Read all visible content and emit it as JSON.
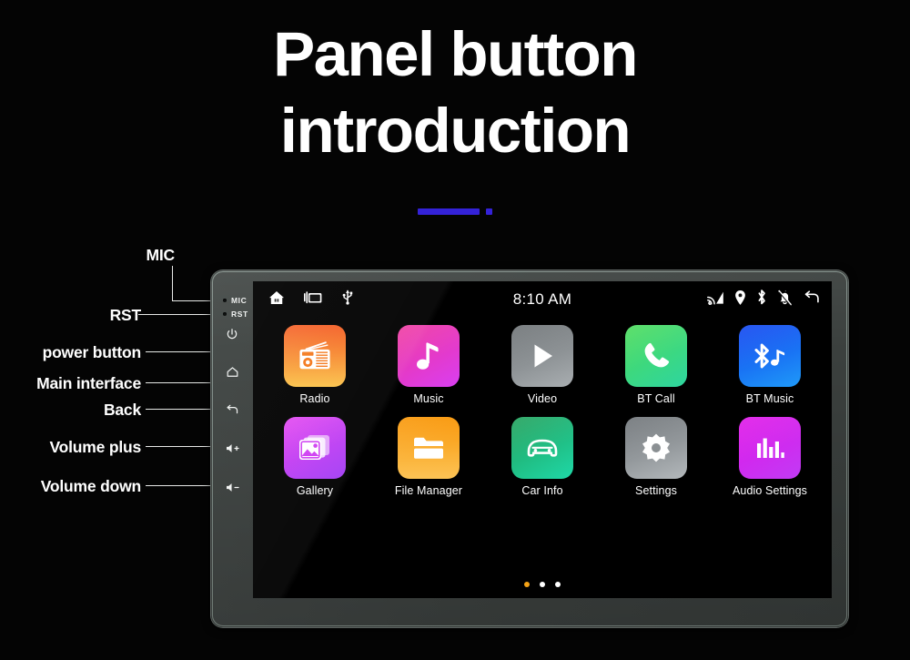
{
  "page": {
    "title_line1": "Panel button",
    "title_line2": "introduction",
    "accent_color": "#3422d8",
    "background_color": "#040404"
  },
  "annotations": [
    {
      "label": "MIC",
      "target": "mic-port"
    },
    {
      "label": "RST",
      "target": "reset-port"
    },
    {
      "label": "power button",
      "target": "power-button"
    },
    {
      "label": "Main interface",
      "target": "home-button"
    },
    {
      "label": "Back",
      "target": "back-button"
    },
    {
      "label": "Volume plus",
      "target": "volume-up-button"
    },
    {
      "label": "Volume down",
      "target": "volume-down-button"
    }
  ],
  "device": {
    "bezel_buttons": [
      {
        "name": "mic-port",
        "glyph_type": "text",
        "text": "MIC"
      },
      {
        "name": "reset-port",
        "glyph_type": "text",
        "text": "RST"
      },
      {
        "name": "power-button",
        "glyph_type": "icon",
        "icon": "power-icon"
      },
      {
        "name": "home-button",
        "glyph_type": "icon",
        "icon": "home-icon"
      },
      {
        "name": "back-button",
        "glyph_type": "icon",
        "icon": "back-arrow-icon"
      },
      {
        "name": "volume-up-button",
        "glyph_type": "icon",
        "icon": "volume-up-icon"
      },
      {
        "name": "volume-down-button",
        "glyph_type": "icon",
        "icon": "volume-down-icon"
      }
    ]
  },
  "screen": {
    "status_bar": {
      "clock": "8:10 AM",
      "left_icons": [
        "home-icon",
        "recent-apps-icon",
        "usb-icon"
      ],
      "right_icons": [
        "cast-icon",
        "location-pin-icon",
        "bluetooth-icon",
        "notifications-off-icon",
        "back-arrow-icon"
      ]
    },
    "apps": [
      {
        "label": "Radio",
        "icon": "radio-icon",
        "color_from": "#f4571b",
        "color_to": "#fbc24a"
      },
      {
        "label": "Music",
        "icon": "music-note-icon",
        "color_from": "#f0339b",
        "color_to": "#d93ff2"
      },
      {
        "label": "Video",
        "icon": "play-icon",
        "color_from": "#6d7275",
        "color_to": "#a9aeb1"
      },
      {
        "label": "BT Call",
        "icon": "phone-icon",
        "color_from": "#4ddc5a",
        "color_to": "#2ed5a0"
      },
      {
        "label": "BT Music",
        "icon": "bluetooth-music-icon",
        "color_from": "#1144f0",
        "color_to": "#1f9af8"
      },
      {
        "label": "Gallery",
        "icon": "gallery-icon",
        "color_from": "#e23df0",
        "color_to": "#a13ef5"
      },
      {
        "label": "File Manager",
        "icon": "folder-icon",
        "color_from": "#f99607",
        "color_to": "#fcc355"
      },
      {
        "label": "Car Info",
        "icon": "car-icon",
        "color_from": "#21a05a",
        "color_to": "#1fd8a8"
      },
      {
        "label": "Settings",
        "icon": "gear-icon",
        "color_from": "#6e7377",
        "color_to": "#b3b8bb"
      },
      {
        "label": "Audio Settings",
        "icon": "equalizer-icon",
        "color_from": "#e017e8",
        "color_to": "#c13bf5"
      }
    ],
    "page_dots": {
      "count": 3,
      "active_index": 0,
      "active_color": "#f5a316",
      "inactive_color": "#ffffff"
    }
  }
}
